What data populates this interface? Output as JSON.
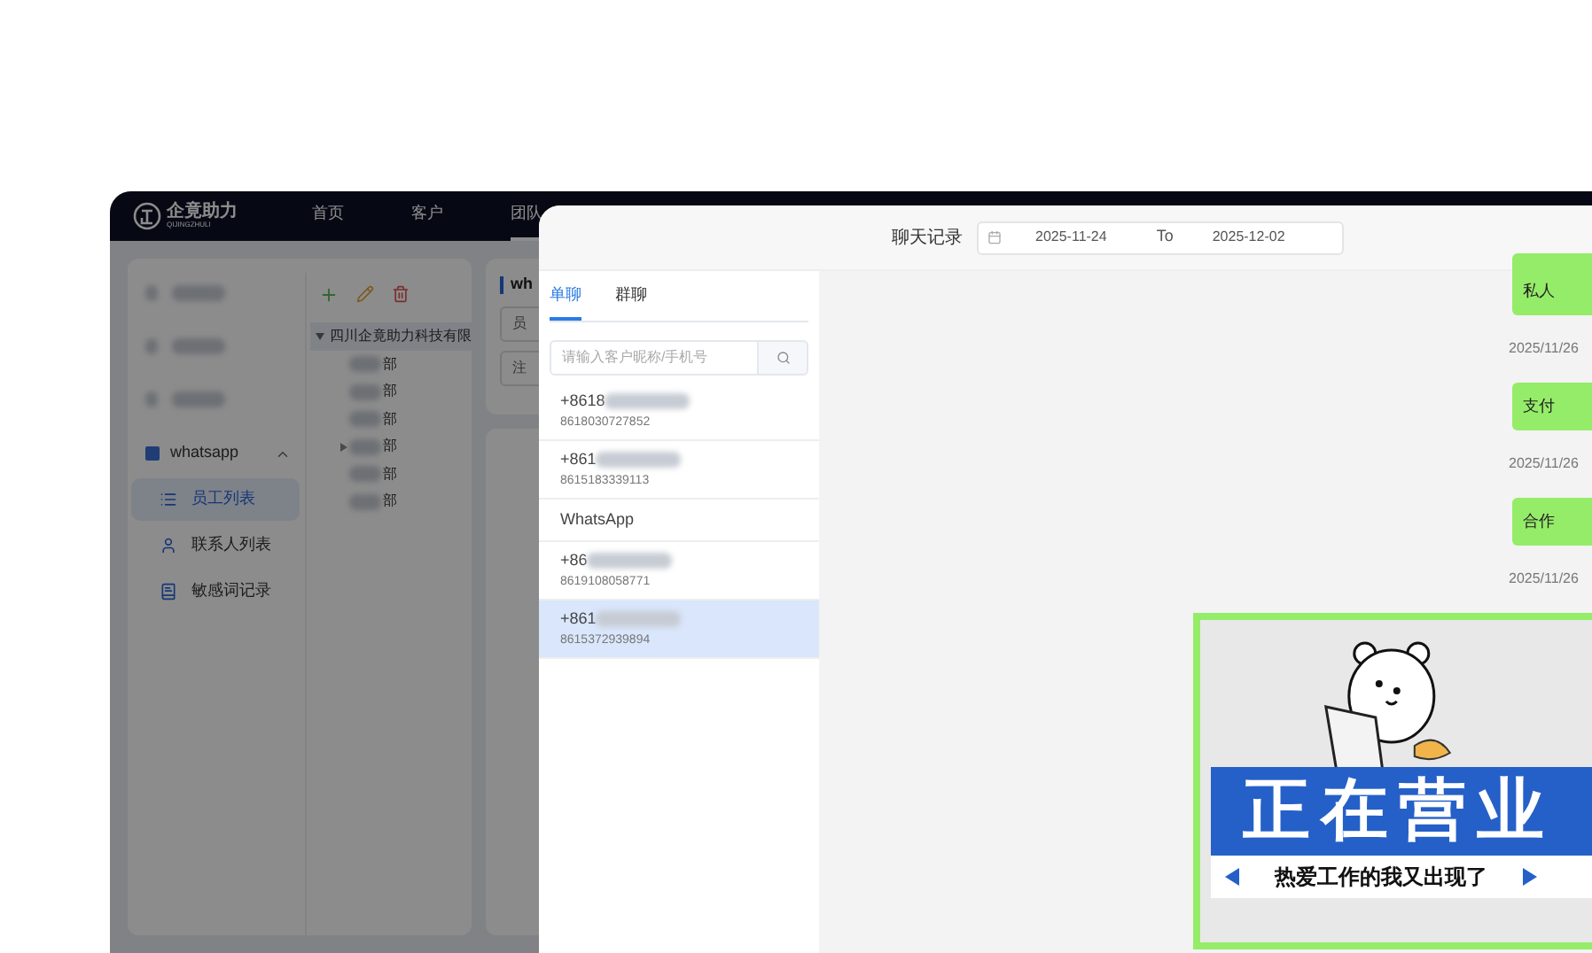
{
  "app": {
    "logo": {
      "name": "企竟助力",
      "sub": "QIJINGZHULI"
    },
    "nav": [
      {
        "label": "首页",
        "selected": false
      },
      {
        "label": "客户",
        "selected": false
      },
      {
        "label": "团队",
        "selected": true
      }
    ],
    "sidebar": {
      "group": {
        "label": "whatsapp",
        "expanded": true,
        "items": [
          {
            "label": "员工列表",
            "selected": true,
            "kind": "list"
          },
          {
            "label": "联系人列表",
            "selected": false,
            "kind": "person"
          },
          {
            "label": "敏感词记录",
            "selected": false,
            "kind": "book"
          }
        ]
      }
    },
    "tree": {
      "root": {
        "label": "四川企竟助力科技有限",
        "expanded": true,
        "children": [
          {
            "label": "部",
            "has_children": false
          },
          {
            "label": "部",
            "has_children": false
          },
          {
            "label": "部",
            "has_children": false
          },
          {
            "label": "部",
            "has_children": true
          },
          {
            "label": "部",
            "has_children": false
          },
          {
            "label": "部",
            "has_children": false
          }
        ]
      }
    },
    "panel": {
      "title": "wh",
      "fields": [
        "员",
        "注"
      ]
    }
  },
  "drawer": {
    "title": "聊天记录",
    "date_range": {
      "start": "2025-11-24",
      "separator": "To",
      "end": "2025-12-02"
    },
    "tabs": [
      {
        "label": "单聊",
        "selected": true
      },
      {
        "label": "群聊",
        "selected": false
      }
    ],
    "search": {
      "placeholder": "请输入客户昵称/手机号"
    },
    "contacts": [
      {
        "name": "+8618",
        "number": "8618030727852",
        "selected": false
      },
      {
        "name": "+861",
        "number": "8615183339113",
        "selected": false
      },
      {
        "name": "WhatsApp",
        "selected": false
      },
      {
        "name": "+86",
        "number": "8619108058771",
        "selected": false
      },
      {
        "name": "+861",
        "number": "8615372939894",
        "selected": true
      }
    ],
    "messages": [
      {
        "kind": "text",
        "text": "私人"
      },
      {
        "kind": "time",
        "text": "2025/11/26"
      },
      {
        "kind": "text",
        "text": "支付"
      },
      {
        "kind": "time",
        "text": "2025/11/26"
      },
      {
        "kind": "text",
        "text": "合作"
      },
      {
        "kind": "time",
        "text": "2025/11/26"
      },
      {
        "kind": "sticker",
        "headline": "正在营业",
        "caption": "热爱工作的我又出现了"
      }
    ]
  }
}
